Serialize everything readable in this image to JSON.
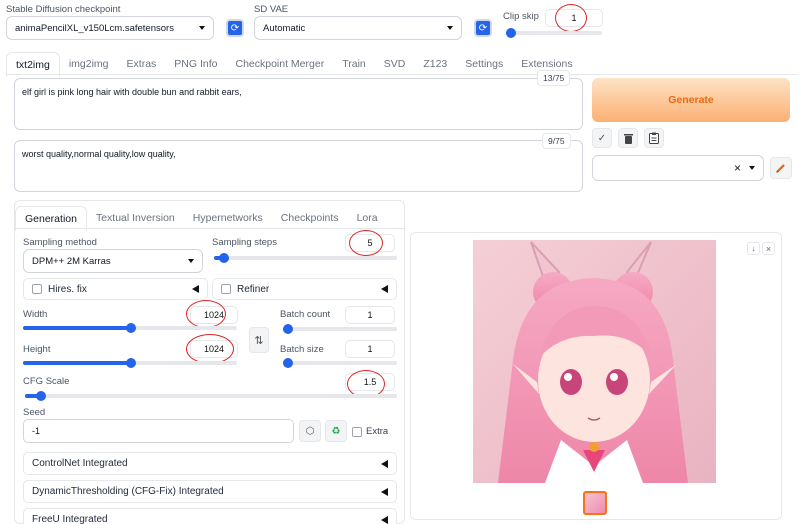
{
  "top": {
    "checkpoint_label": "Stable Diffusion checkpoint",
    "checkpoint_value": "animaPencilXL_v150Lcm.safetensors",
    "vae_label": "SD VAE",
    "vae_value": "Automatic",
    "clipskip_label": "Clip skip",
    "clipskip_value": "1",
    "clipskip_fraction": 0.0
  },
  "main_tabs": [
    "txt2img",
    "img2img",
    "Extras",
    "PNG Info",
    "Checkpoint Merger",
    "Train",
    "SVD",
    "Z123",
    "Settings",
    "Extensions"
  ],
  "prompt": {
    "positive": "elf girl is pink long hair with double bun and rabbit ears,",
    "positive_count": "13/75",
    "negative": "worst quality,normal quality,low quality,",
    "negative_count": "9/75"
  },
  "generate_label": "Generate",
  "styles": {
    "clear_symbol": "×"
  },
  "sub_tabs": [
    "Generation",
    "Textual Inversion",
    "Hypernetworks",
    "Checkpoints",
    "Lora"
  ],
  "params": {
    "sampling_method_label": "Sampling method",
    "sampling_method_value": "DPM++ 2M Karras",
    "sampling_steps_label": "Sampling steps",
    "sampling_steps_value": "5",
    "sampling_steps_fraction": 0.03,
    "hires_label": "Hires. fix",
    "refiner_label": "Refiner",
    "width_label": "Width",
    "width_value": "1024",
    "width_fraction": 0.48,
    "height_label": "Height",
    "height_value": "1024",
    "height_fraction": 0.48,
    "batch_count_label": "Batch count",
    "batch_count_value": "1",
    "batch_size_label": "Batch size",
    "batch_size_value": "1",
    "cfg_label": "CFG Scale",
    "cfg_value": "1.5",
    "cfg_fraction": 0.03,
    "seed_label": "Seed",
    "seed_value": "-1",
    "extra_label": "Extra"
  },
  "accordions": [
    "ControlNet Integrated",
    "DynamicThresholding (CFG-Fix) Integrated",
    "FreeU Integrated"
  ],
  "colors": {
    "accent": "#2563eb",
    "generate_from": "#fde0c2",
    "generate_to": "#fcb77a",
    "generate_text": "#e8650f",
    "annotation": "#dc2626"
  },
  "icons": [
    "refresh-icon",
    "check-icon",
    "trash-icon",
    "clipboard-icon",
    "pencil-icon",
    "swap-icon",
    "dice-icon",
    "recycle-icon",
    "download-icon",
    "close-icon"
  ]
}
